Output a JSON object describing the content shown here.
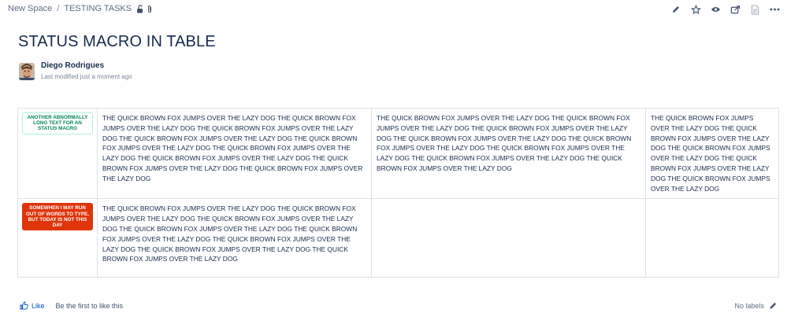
{
  "breadcrumb": {
    "space": "New Space",
    "separator": "/",
    "parent": "TESTING TASKS"
  },
  "page": {
    "title": "STATUS MACRO IN TABLE"
  },
  "byline": {
    "author": "Diego Rodrigues",
    "modified": "Last modified just a moment ago"
  },
  "actions": [
    "edit-icon",
    "star-icon",
    "watch-icon",
    "share-icon",
    "page-history-icon",
    "more-icon"
  ],
  "table": {
    "rows": [
      {
        "status": {
          "text": "ANOTHER ABNORMALLY LONG TEXT FOR AN STATUS MACRO",
          "color": "green"
        },
        "cells": [
          "THE QUICK BROWN FOX JUMPS OVER THE LAZY DOG THE QUICK BROWN FOX JUMPS OVER THE LAZY DOG THE QUICK BROWN FOX JUMPS OVER THE LAZY DOG THE QUICK BROWN FOX JUMPS OVER THE LAZY DOG THE QUICK BROWN FOX JUMPS OVER THE LAZY DOG THE QUICK BROWN FOX JUMPS OVER THE LAZY DOG THE QUICK BROWN FOX JUMPS OVER THE LAZY DOG THE QUICK BROWN FOX JUMPS OVER THE LAZY DOG THE QUICK BROWN FOX JUMPS OVER THE LAZY DOG",
          "THE QUICK BROWN FOX JUMPS OVER THE LAZY DOG THE QUICK BROWN FOX JUMPS OVER THE LAZY DOG THE QUICK BROWN FOX JUMPS OVER THE LAZY DOG THE QUICK BROWN FOX JUMPS OVER THE LAZY DOG THE QUICK BROWN FOX JUMPS OVER THE LAZY DOG THE QUICK BROWN FOX JUMPS OVER THE LAZY DOG THE QUICK BROWN FOX JUMPS OVER THE LAZY DOG THE QUICK BROWN FOX JUMPS OVER THE LAZY DOG",
          "THE QUICK BROWN FOX JUMPS OVER THE LAZY DOG THE QUICK BROWN FOX JUMPS OVER THE LAZY DOG THE QUICK BROWN FOX JUMPS OVER THE LAZY DOG THE QUICK BROWN FOX JUMPS OVER THE LAZY DOG THE QUICK BROWN FOX JUMPS OVER THE LAZY DOG"
        ]
      },
      {
        "status": {
          "text": "SOMEWHEN I MAY RUN OUT OF WORDS TO TYPE, BUT TODAY IS NOT THIS DAY",
          "color": "red"
        },
        "cells": [
          "THE QUICK BROWN FOX JUMPS OVER THE LAZY DOG THE QUICK BROWN FOX JUMPS OVER THE LAZY DOG THE QUICK BROWN FOX JUMPS OVER THE LAZY DOG THE QUICK BROWN FOX JUMPS OVER THE LAZY DOG THE QUICK BROWN FOX JUMPS OVER THE LAZY DOG THE QUICK BROWN FOX JUMPS OVER THE LAZY DOG THE QUICK BROWN FOX JUMPS OVER THE LAZY DOG THE QUICK BROWN FOX JUMPS OVER THE LAZY DOG",
          "",
          ""
        ]
      }
    ]
  },
  "footer": {
    "like_label": "Like",
    "like_prompt": "Be the first to like this",
    "labels_text": "No labels"
  },
  "colors": {
    "text": "#172b4d",
    "link": "#0052cc",
    "muted": "#7a869a",
    "border": "#dfe1e6",
    "status_green": "#00875a",
    "status_red": "#de350b"
  }
}
